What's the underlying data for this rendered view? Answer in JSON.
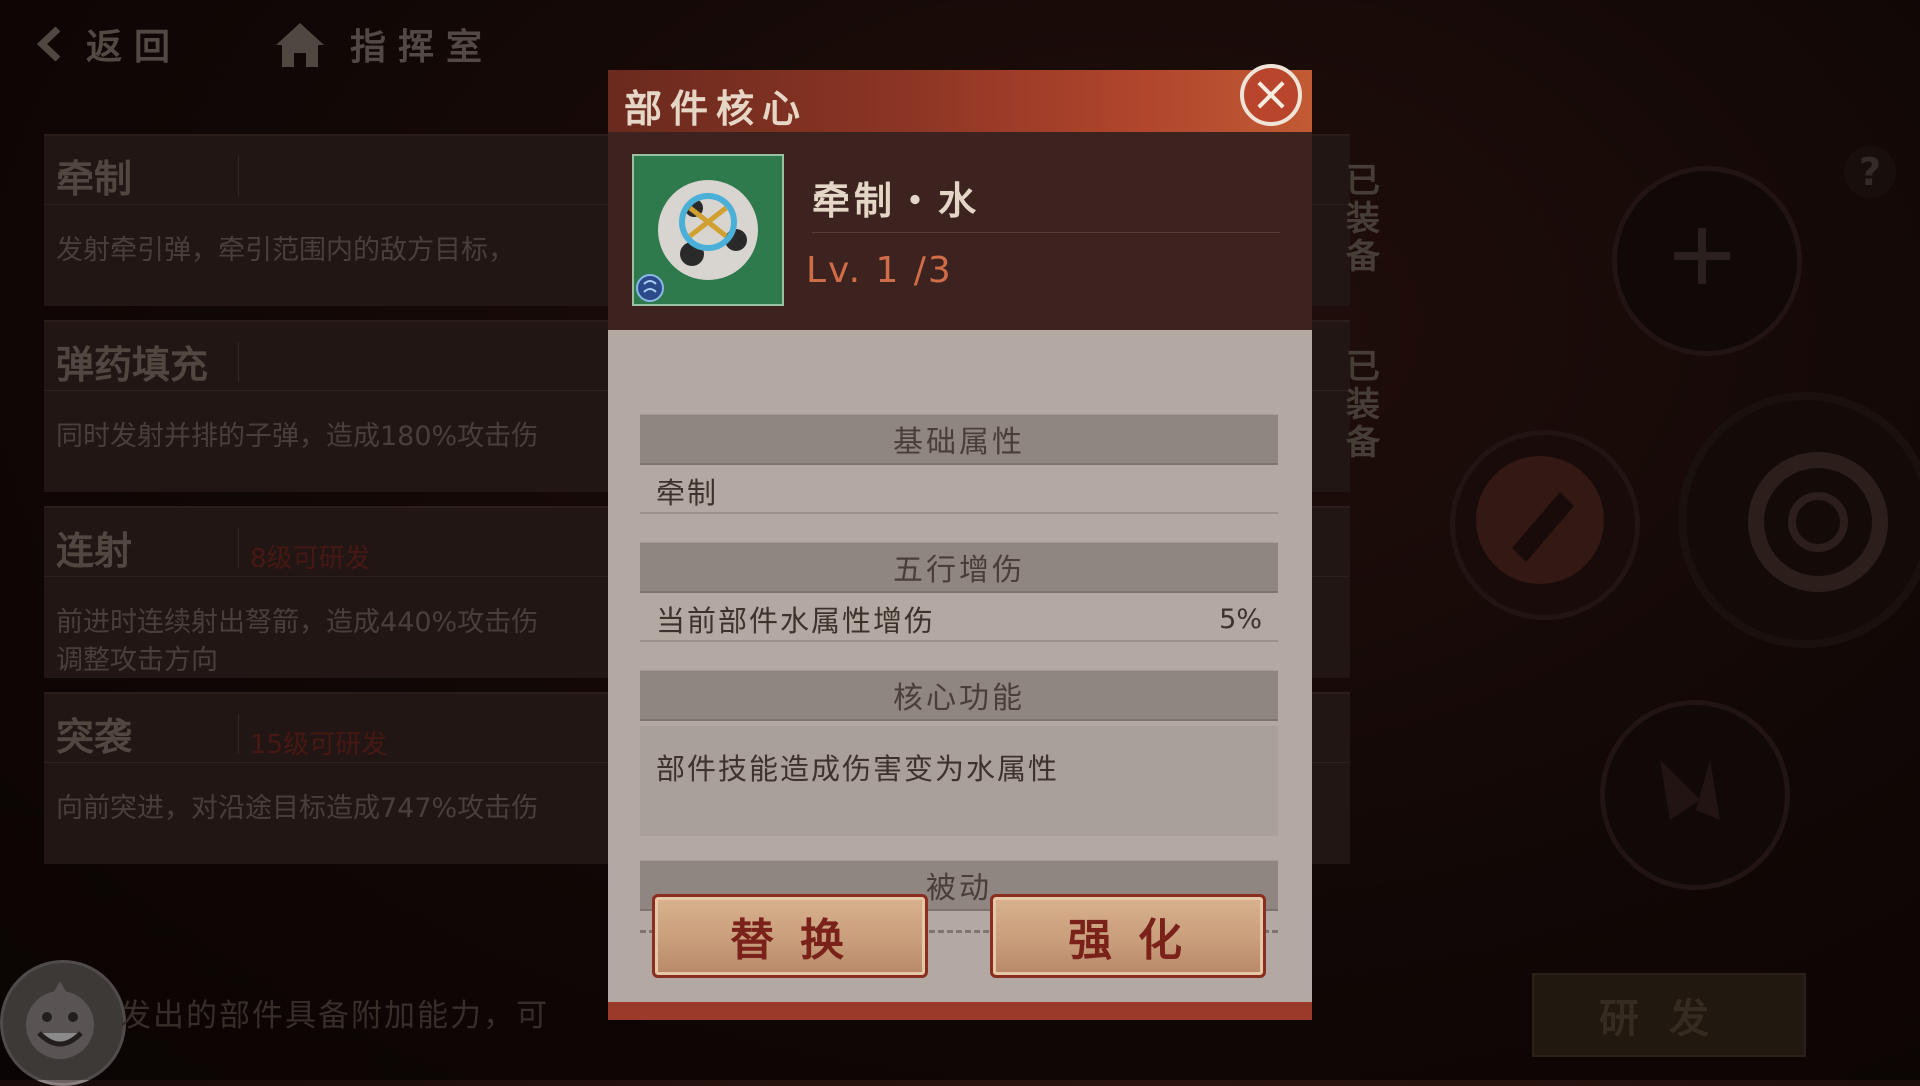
{
  "topbar": {
    "back_label": "返回",
    "home_label": "指挥室"
  },
  "skills": [
    {
      "name": "牵制",
      "status": "",
      "desc": [
        "发射牵引弹，牵引范围内的敌方目标，"
      ],
      "equipped": "已装备"
    },
    {
      "name": "弹药填充",
      "status": "",
      "desc": [
        "同时发射并排的子弹，造成180%攻击伤"
      ],
      "equipped": "已装备"
    },
    {
      "name": "连射",
      "status": "8级可研发",
      "desc": [
        "前进时连续射出弩箭，造成440%攻击伤",
        "调整攻击方向"
      ],
      "equipped": ""
    },
    {
      "name": "突袭",
      "status": "15级可研发",
      "desc": [
        "向前突进，对沿途目标造成747%攻击伤"
      ],
      "equipped": ""
    }
  ],
  "bottom_hint": "发出的部件具备附加能力，可",
  "research_label": "研发",
  "help_label": "?",
  "dialog": {
    "title": "部件核心",
    "close_icon": "close-icon",
    "item": {
      "name": "牵制・水",
      "level": "Lv. 1 /3",
      "element_badge": "water-icon"
    },
    "sections": {
      "base_title": "基础属性",
      "base_value": "牵制",
      "element_title": "五行增伤",
      "element_row_label": "当前部件水属性增伤",
      "element_row_value": "5%",
      "core_title": "核心功能",
      "core_desc": "部件技能造成伤害变为水属性",
      "passive_title": "被动"
    },
    "buttons": {
      "replace": "替换",
      "enhance": "强化"
    }
  },
  "colors": {
    "accent_red": "#b9452c",
    "level_orange": "#d06c48",
    "item_bg_green": "#2f7a4c"
  }
}
